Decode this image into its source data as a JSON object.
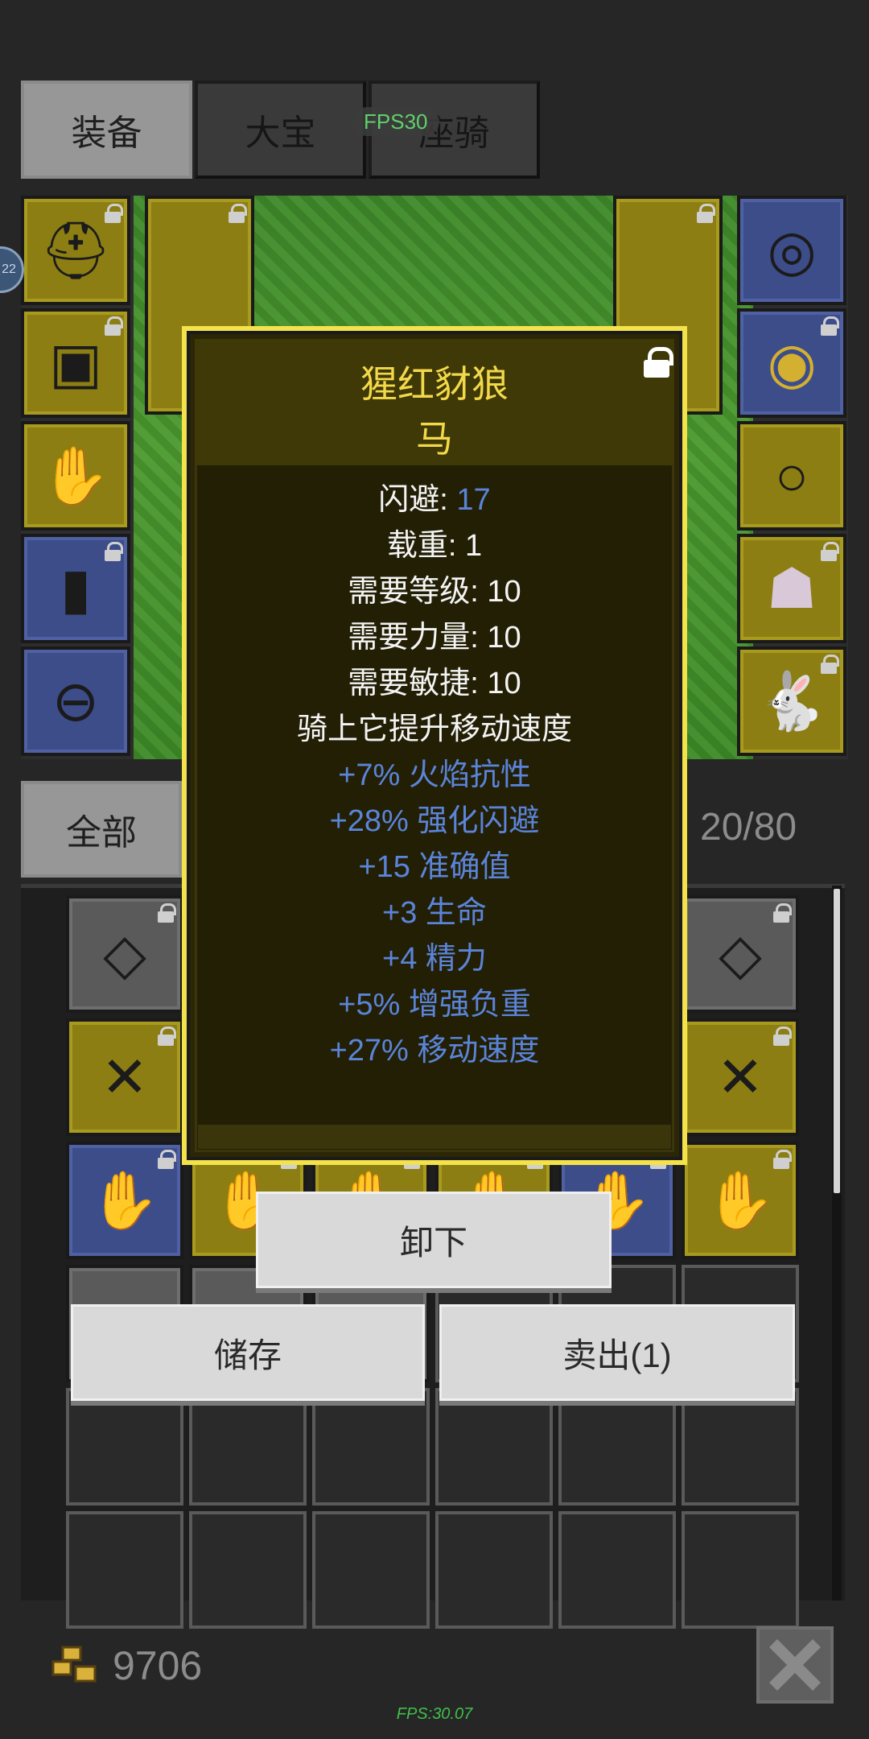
{
  "tabs": [
    {
      "label": "装备",
      "active": true
    },
    {
      "label": "大宝",
      "active": false
    },
    {
      "label": "座骑",
      "active": false
    }
  ],
  "fps_overlay": "FPS30",
  "side_badge": "22",
  "inventory": {
    "filter_label": "全部",
    "count": "20/80"
  },
  "popup": {
    "name": "猩红豺狼",
    "type": "马",
    "stats": [
      {
        "label": "闪避: ",
        "value": "17"
      },
      {
        "label": "载重: 1"
      },
      {
        "label": "需要等级: 10"
      },
      {
        "label": "需要力量: 10"
      },
      {
        "label": "需要敏捷: 10"
      },
      {
        "label": "骑上它提升移动速度"
      }
    ],
    "bonuses": [
      "+7% 火焰抗性",
      "+28% 强化闪避",
      "+15 准确值",
      "+3 生命",
      "+4 精力",
      "+5% 增强负重",
      "+27% 移动速度"
    ]
  },
  "actions": {
    "unequip": "卸下",
    "store": "储存",
    "sell": "卖出(1)"
  },
  "gold": "9706",
  "fps_footer": "FPS:30.07",
  "colors": {
    "slot_gold": "#8c7e13",
    "slot_blue": "#3c4d8a",
    "popup_border": "#f3e24a",
    "title_yellow": "#f2d94a",
    "bonus_blue": "#5b84d9"
  }
}
